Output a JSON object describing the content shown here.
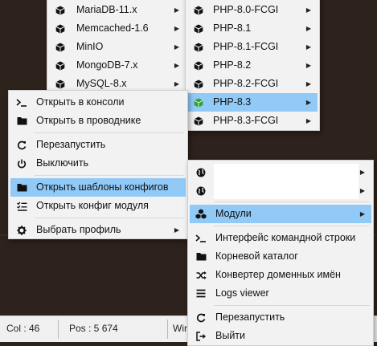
{
  "status_bar": {
    "col": "Col : 46",
    "pos": "Pos : 5 674",
    "win": "Wir"
  },
  "menu_modules": [
    {
      "label": "MariaDB-11.x",
      "icon": "cube-icon",
      "arrow": true
    },
    {
      "label": "Memcached-1.6",
      "icon": "cube-icon",
      "arrow": true
    },
    {
      "label": "MinIO",
      "icon": "cube-icon",
      "arrow": true
    },
    {
      "label": "MongoDB-7.x",
      "icon": "cube-icon",
      "arrow": true
    },
    {
      "label": "MySQL-8.x",
      "icon": "cube-icon",
      "arrow": true
    }
  ],
  "menu_php": [
    {
      "label": "PHP-8.0-FCGI",
      "icon": "cube-icon",
      "arrow": true
    },
    {
      "label": "PHP-8.1",
      "icon": "cube-icon",
      "arrow": true
    },
    {
      "label": "PHP-8.1-FCGI",
      "icon": "cube-icon",
      "arrow": true
    },
    {
      "label": "PHP-8.2",
      "icon": "cube-icon",
      "arrow": true
    },
    {
      "label": "PHP-8.2-FCGI",
      "icon": "cube-icon",
      "arrow": true
    },
    {
      "label": "PHP-8.3",
      "icon": "green-cube-icon",
      "arrow": true,
      "highlighted": true
    },
    {
      "label": "PHP-8.3-FCGI",
      "icon": "cube-icon",
      "arrow": true
    }
  ],
  "menu_context": {
    "open_console": "Открыть в консоли",
    "open_explorer": "Открыть в проводнике",
    "restart": "Перезапустить",
    "shutdown": "Выключить",
    "open_templates": "Открыть шаблоны конфигов",
    "open_module_config": "Открыть конфиг модуля",
    "choose_profile": "Выбрать профиль"
  },
  "menu_tray": {
    "modules": "Модули",
    "cli": "Интерфейс командной строки",
    "root": "Корневой каталог",
    "domain_converter": "Конвертер доменных имён",
    "logs_viewer": "Logs viewer",
    "restart": "Перезапустить",
    "exit": "Выйти"
  },
  "colors": {
    "highlight": "#91c9f7",
    "menu_bg": "#f2f2f2",
    "desktop": "#2d221c",
    "accent_green": "#3cb043"
  }
}
